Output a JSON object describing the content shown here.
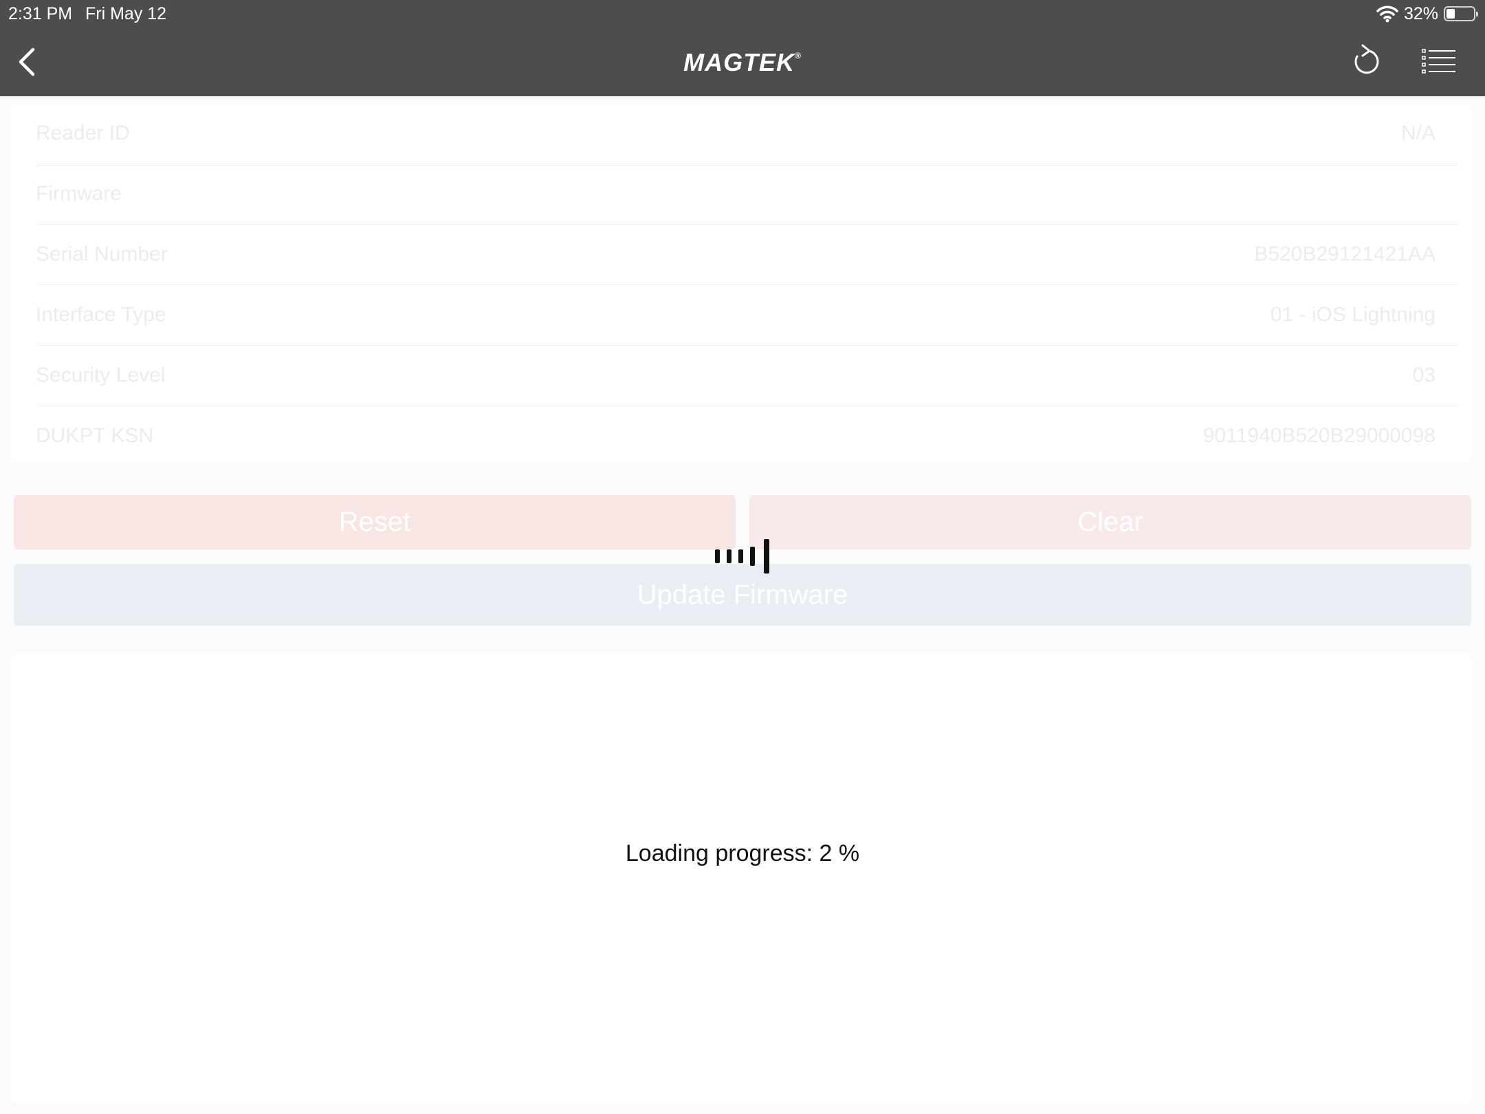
{
  "status_bar": {
    "time": "2:31 PM",
    "date": "Fri May 12",
    "battery_percent": "32%",
    "battery_level": 0.32,
    "wifi_icon": "wifi-icon",
    "battery_icon": "battery-icon"
  },
  "header": {
    "logo_text": "MAGTEK",
    "logo_mark": "®",
    "back_icon": "chevron-left-icon",
    "refresh_icon": "refresh-icon",
    "menu_icon": "list-icon",
    "background_color": "#4f4c4d"
  },
  "device_info": {
    "rows": [
      {
        "label": "Reader ID",
        "value": "N/A"
      },
      {
        "label": "Firmware",
        "value": ""
      },
      {
        "label": "Serial Number",
        "value": "B520B29121421AA"
      },
      {
        "label": "Interface Type",
        "value": "01 - iOS Lightning"
      },
      {
        "label": "Security Level",
        "value": "03"
      },
      {
        "label": "DUKPT KSN",
        "value": "9011940B520B29000098"
      }
    ]
  },
  "actions": {
    "reset_label": "Reset",
    "clear_label": "Clear",
    "update_firmware_label": "Update Firmware",
    "reset_color": "#f8e6e5",
    "clear_color": "#f8eaea",
    "update_color": "#e9eef5"
  },
  "loading": {
    "spinner_icon": "loading-bars-icon",
    "progress_text": "Loading progress: 2 %",
    "progress_value": 2
  }
}
